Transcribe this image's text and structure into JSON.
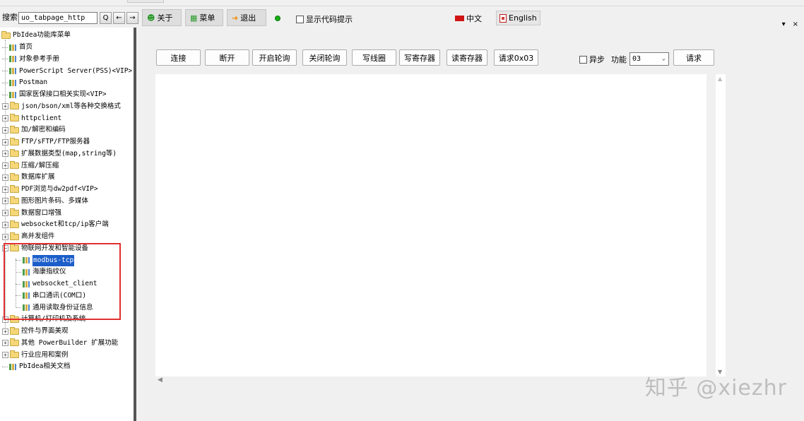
{
  "toolbar": {
    "search_label": "搜索",
    "search_value": "uo_tabpage_http",
    "search_btn": "Q",
    "back_btn": "←",
    "fwd_btn": "→",
    "about": "关于",
    "menu": "菜单",
    "exit": "退出",
    "show_code_hint": "显示代码提示",
    "lang_cn": "中文",
    "lang_en": "English",
    "win_menu": "▾",
    "win_close": "×"
  },
  "tree": {
    "root": "PbIdea功能库菜单",
    "items": [
      {
        "label": "首页",
        "kind": "page"
      },
      {
        "label": "对象参考手册",
        "kind": "page"
      },
      {
        "label": "PowerScript Server(PSS)<VIP>",
        "kind": "page"
      },
      {
        "label": "Postman",
        "kind": "page"
      },
      {
        "label": "国家医保接口相关实现<VIP>",
        "kind": "page"
      },
      {
        "label": "json/bson/xml等各种交换格式",
        "kind": "folder"
      },
      {
        "label": "httpclient",
        "kind": "folder"
      },
      {
        "label": "加/解密和编码",
        "kind": "folder"
      },
      {
        "label": "FTP/sFTP/FTP服务器",
        "kind": "folder"
      },
      {
        "label": "扩展数据类型(map,string等)",
        "kind": "folder"
      },
      {
        "label": "压缩/解压缩",
        "kind": "folder"
      },
      {
        "label": "数据库扩展",
        "kind": "folder"
      },
      {
        "label": "PDF浏览与dw2pdf<VIP>",
        "kind": "folder"
      },
      {
        "label": "图形图片条码、多媒体",
        "kind": "folder"
      },
      {
        "label": "数据窗口增强",
        "kind": "folder"
      },
      {
        "label": "websocket和tcp/ip客户端",
        "kind": "folder"
      },
      {
        "label": "高并发组件",
        "kind": "folder"
      },
      {
        "label": "物联网开发和智能设备",
        "kind": "folder-open"
      },
      {
        "label": "modbus-tcp",
        "kind": "child-selected"
      },
      {
        "label": "海康指纹仪",
        "kind": "child"
      },
      {
        "label": "websocket_client",
        "kind": "child"
      },
      {
        "label": "串口通讯(COM口)",
        "kind": "child"
      },
      {
        "label": "通用读取身份证信息",
        "kind": "child"
      },
      {
        "label": "计算机/打印机及系统",
        "kind": "folder"
      },
      {
        "label": "控件与界面美观",
        "kind": "folder"
      },
      {
        "label": "其他 PowerBuilder 扩展功能",
        "kind": "folder"
      },
      {
        "label": "行业应用和案例",
        "kind": "folder"
      },
      {
        "label": "PbIdea相关文档",
        "kind": "page"
      }
    ]
  },
  "actions": {
    "connect": "连接",
    "disconnect": "断开",
    "start_poll": "开启轮询",
    "stop_poll": "关闭轮询",
    "write_coil": "写线圈",
    "write_register": "写寄存器",
    "read_register": "读寄存器",
    "request_0x03": "请求0x03",
    "async_label": "异步",
    "func_label": "功能",
    "func_value": "03",
    "request": "请求"
  },
  "watermark": "知乎 @xiezhr"
}
